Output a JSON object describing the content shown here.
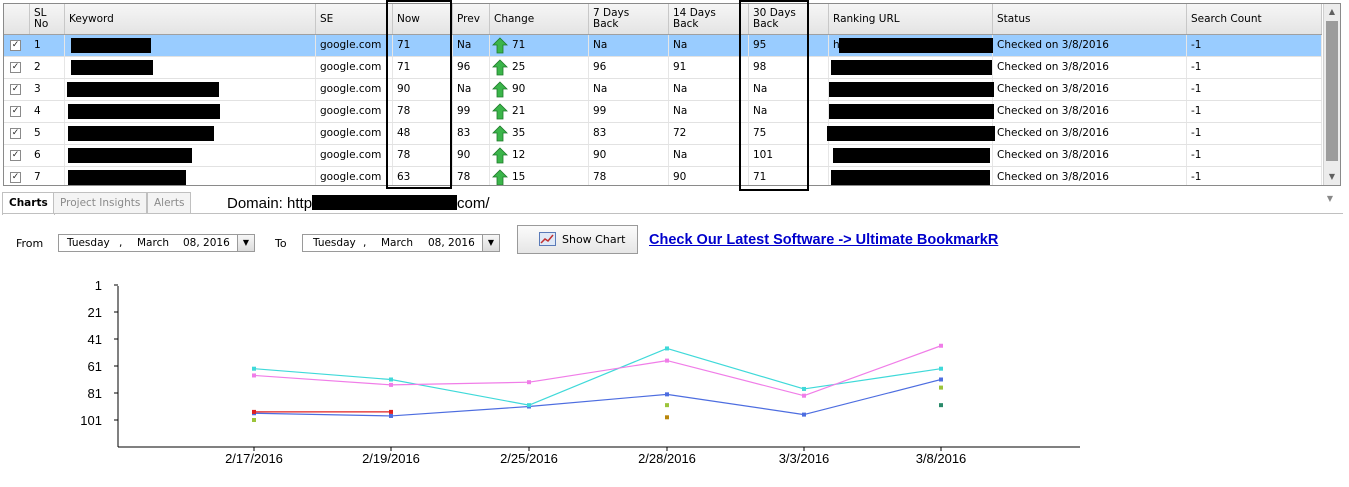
{
  "grid": {
    "columns": [
      {
        "key": "sl",
        "label": "SL\nNo"
      },
      {
        "key": "keyword",
        "label": "Keyword"
      },
      {
        "key": "se",
        "label": "SE"
      },
      {
        "key": "now",
        "label": "Now"
      },
      {
        "key": "prev",
        "label": "Prev"
      },
      {
        "key": "change",
        "label": "Change"
      },
      {
        "key": "d7",
        "label": "7 Days\nBack"
      },
      {
        "key": "d14",
        "label": "14 Days\nBack"
      },
      {
        "key": "d30",
        "label": "30 Days\nBack"
      },
      {
        "key": "url",
        "label": "Ranking URL"
      },
      {
        "key": "status",
        "label": "Status"
      },
      {
        "key": "count",
        "label": "Search Count"
      }
    ],
    "rows": [
      {
        "checked": "✓",
        "sl": "1",
        "se": "google.com",
        "now": "71",
        "prev": "Na",
        "change": "71",
        "d7": "Na",
        "d14": "Na",
        "d30": "95",
        "url_prefix": "h",
        "status": "Checked on 3/8/2016",
        "count": "-1"
      },
      {
        "checked": "✓",
        "sl": "2",
        "se": "google.com",
        "now": "71",
        "prev": "96",
        "change": "25",
        "d7": "96",
        "d14": "91",
        "d30": "98",
        "url_prefix": "",
        "status": "Checked on 3/8/2016",
        "count": "-1"
      },
      {
        "checked": "✓",
        "sl": "3",
        "se": "google.com",
        "now": "90",
        "prev": "Na",
        "change": "90",
        "d7": "Na",
        "d14": "Na",
        "d30": "Na",
        "url_prefix": "",
        "status": "Checked on 3/8/2016",
        "count": "-1"
      },
      {
        "checked": "✓",
        "sl": "4",
        "se": "google.com",
        "now": "78",
        "prev": "99",
        "change": "21",
        "d7": "99",
        "d14": "Na",
        "d30": "Na",
        "url_prefix": "",
        "status": "Checked on 3/8/2016",
        "count": "-1"
      },
      {
        "checked": "✓",
        "sl": "5",
        "se": "google.com",
        "now": "48",
        "prev": "83",
        "change": "35",
        "d7": "83",
        "d14": "72",
        "d30": "75",
        "url_prefix": "",
        "status": "Checked on 3/8/2016",
        "count": "-1"
      },
      {
        "checked": "✓",
        "sl": "6",
        "se": "google.com",
        "now": "78",
        "prev": "90",
        "change": "12",
        "d7": "90",
        "d14": "Na",
        "d30": "101",
        "url_prefix": "",
        "status": "Checked on 3/8/2016",
        "count": "-1"
      },
      {
        "checked": "✓",
        "sl": "7",
        "se": "google.com",
        "now": "63",
        "prev": "78",
        "change": "15",
        "d7": "78",
        "d14": "90",
        "d30": "71",
        "url_prefix": "",
        "status": "Checked on 3/8/2016",
        "count": "-1"
      }
    ]
  },
  "tabs": [
    {
      "label": "Charts",
      "active": true
    },
    {
      "label": "Project Insights",
      "active": false
    },
    {
      "label": "Alerts",
      "active": false
    }
  ],
  "domain": {
    "prefix": "Domain: http",
    "suffix": "com/"
  },
  "toolbar": {
    "from_label": "From",
    "to_label": "To",
    "from_date": {
      "day": "Tuesday",
      "sep": ",",
      "month": "March",
      "date": "08, 2016"
    },
    "to_date": {
      "day": "Tuesday",
      "sep": ",",
      "month": "March",
      "date": "08, 2016"
    },
    "show_chart_label": "Show Chart",
    "promo_link": "Check Our Latest Software -> Ultimate BookmarkR"
  },
  "chart_data": {
    "type": "line",
    "categories": [
      "2/17/2016",
      "2/19/2016",
      "2/25/2016",
      "2/28/2016",
      "3/3/2016",
      "3/8/2016"
    ],
    "ylim": [
      1,
      101
    ],
    "y_reversed": true,
    "yticks": [
      1,
      21,
      41,
      61,
      81,
      101
    ],
    "series": [
      {
        "color": "#4d6de0",
        "values": [
          96,
          98,
          91,
          82,
          97,
          71
        ]
      },
      {
        "color": "#3fd9d9",
        "values": [
          63,
          71,
          90,
          48,
          78,
          63
        ]
      },
      {
        "color": "#f07de8",
        "values": [
          68,
          75,
          73,
          57,
          83,
          46
        ]
      },
      {
        "color": "#e02020",
        "values": [
          95,
          95,
          null,
          null,
          null,
          null
        ]
      },
      {
        "color": "#9cc43a",
        "values": [
          101,
          null,
          null,
          90,
          null,
          77
        ]
      },
      {
        "color": "#b8860b",
        "values": [
          null,
          null,
          null,
          99,
          null,
          null
        ]
      },
      {
        "color": "#2a8a6a",
        "values": [
          null,
          null,
          null,
          null,
          null,
          90
        ]
      }
    ]
  },
  "colors": {
    "selection": "#99ccff",
    "arrow_up": "#3bb54a",
    "link": "#0000cc"
  }
}
